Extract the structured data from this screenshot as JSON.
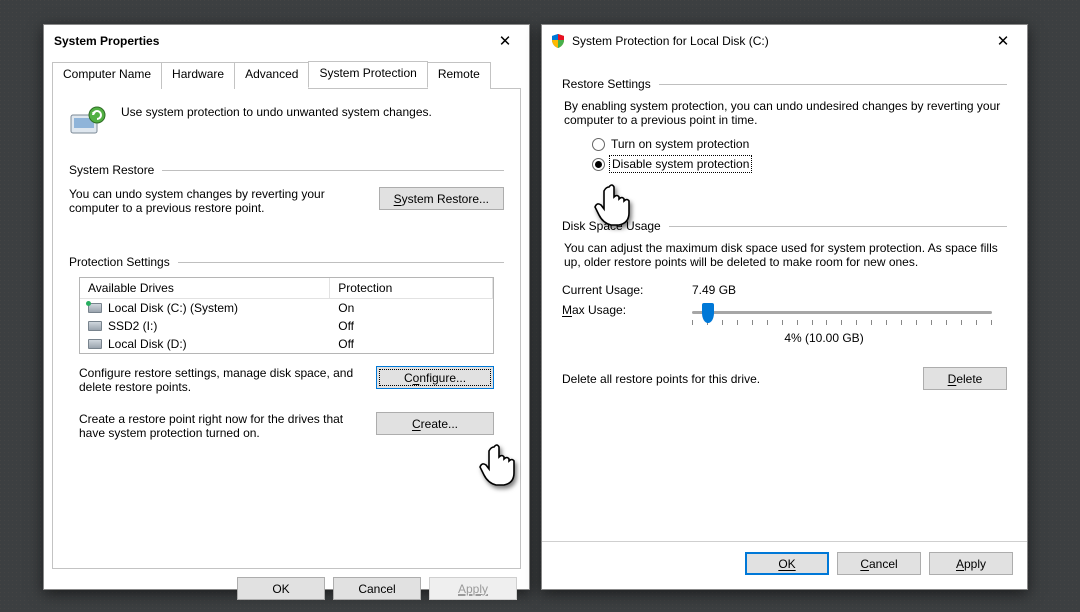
{
  "left": {
    "title": "System Properties",
    "tabs": [
      "Computer Name",
      "Hardware",
      "Advanced",
      "System Protection",
      "Remote"
    ],
    "active_tab": "System Protection",
    "intro": "Use system protection to undo unwanted system changes.",
    "restore_legend": "System Restore",
    "restore_desc": "You can undo system changes by reverting your computer to a previous restore point.",
    "restore_btn": "System Restore...",
    "settings_legend": "Protection Settings",
    "table": {
      "headers": [
        "Available Drives",
        "Protection"
      ],
      "rows": [
        {
          "drive": "Local Disk (C:) (System)",
          "protection": "On",
          "accent": true
        },
        {
          "drive": "SSD2 (I:)",
          "protection": "Off",
          "accent": false
        },
        {
          "drive": "Local Disk (D:)",
          "protection": "Off",
          "accent": false
        }
      ]
    },
    "configure_desc": "Configure restore settings, manage disk space, and delete restore points.",
    "configure_btn": "Configure...",
    "create_desc": "Create a restore point right now for the drives that have system protection turned on.",
    "create_btn": "Create...",
    "footer": {
      "ok": "OK",
      "cancel": "Cancel",
      "apply": "Apply"
    }
  },
  "right": {
    "title": "System Protection for Local Disk (C:)",
    "restore_legend": "Restore Settings",
    "restore_desc": "By enabling system protection, you can undo undesired changes by reverting your computer to a previous point in time.",
    "radio_on": "Turn on system protection",
    "radio_off": "Disable system protection",
    "selected": "off",
    "disk_legend": "Disk Space Usage",
    "disk_desc": "You can adjust the maximum disk space used for system protection. As space fills up, older restore points will be deleted to make room for new ones.",
    "current_label": "Current Usage:",
    "current_value": "7.49 GB",
    "max_label": "Max Usage:",
    "max_caption": "4% (10.00 GB)",
    "delete_desc": "Delete all restore points for this drive.",
    "delete_btn": "Delete",
    "footer": {
      "ok": "OK",
      "cancel": "Cancel",
      "apply": "Apply"
    }
  }
}
